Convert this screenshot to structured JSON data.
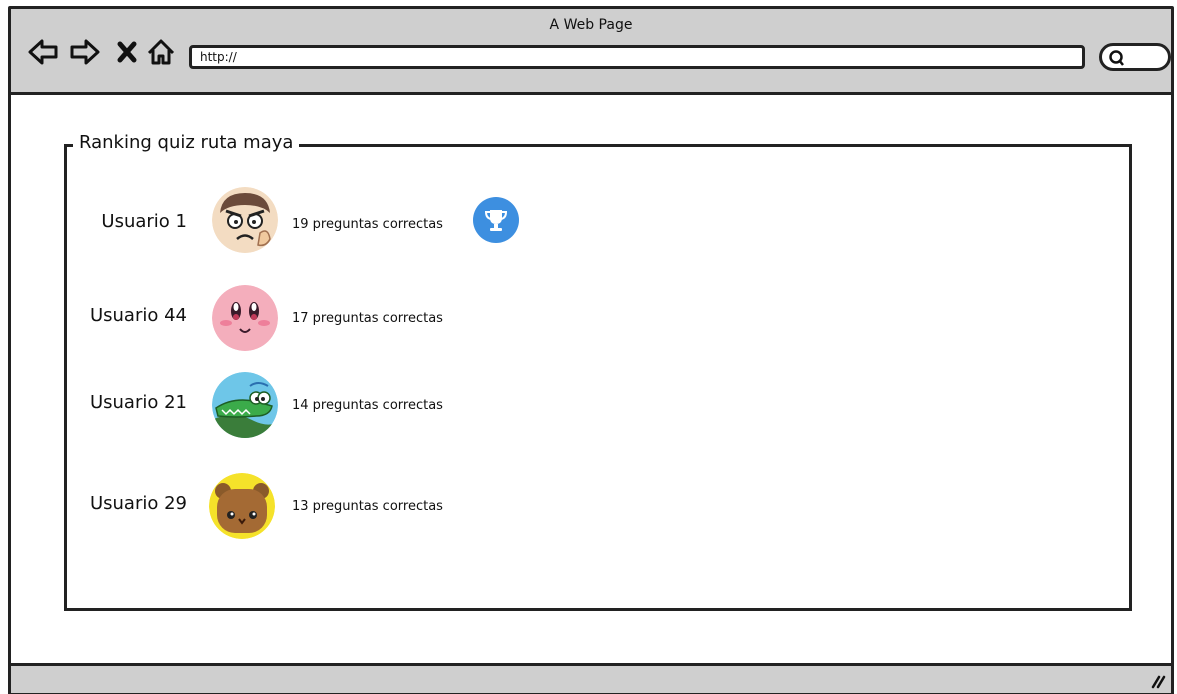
{
  "window": {
    "title": "A Web Page",
    "url": "http://"
  },
  "panel": {
    "legend": "Ranking quiz ruta maya"
  },
  "ranking": [
    {
      "user": "Usuario 1",
      "score": "19 preguntas correctas",
      "avatar": "angry-boy-avatar",
      "trophy": true
    },
    {
      "user": "Usuario 44",
      "score": "17 preguntas correctas",
      "avatar": "pink-blob-avatar",
      "trophy": false
    },
    {
      "user": "Usuario 21",
      "score": "14 preguntas correctas",
      "avatar": "crocodile-avatar",
      "trophy": false
    },
    {
      "user": "Usuario 29",
      "score": "13 preguntas correctas",
      "avatar": "bear-avatar",
      "trophy": false
    }
  ],
  "colors": {
    "chrome": "#cfcfcf",
    "trophy_bg": "#3d8fe0"
  }
}
